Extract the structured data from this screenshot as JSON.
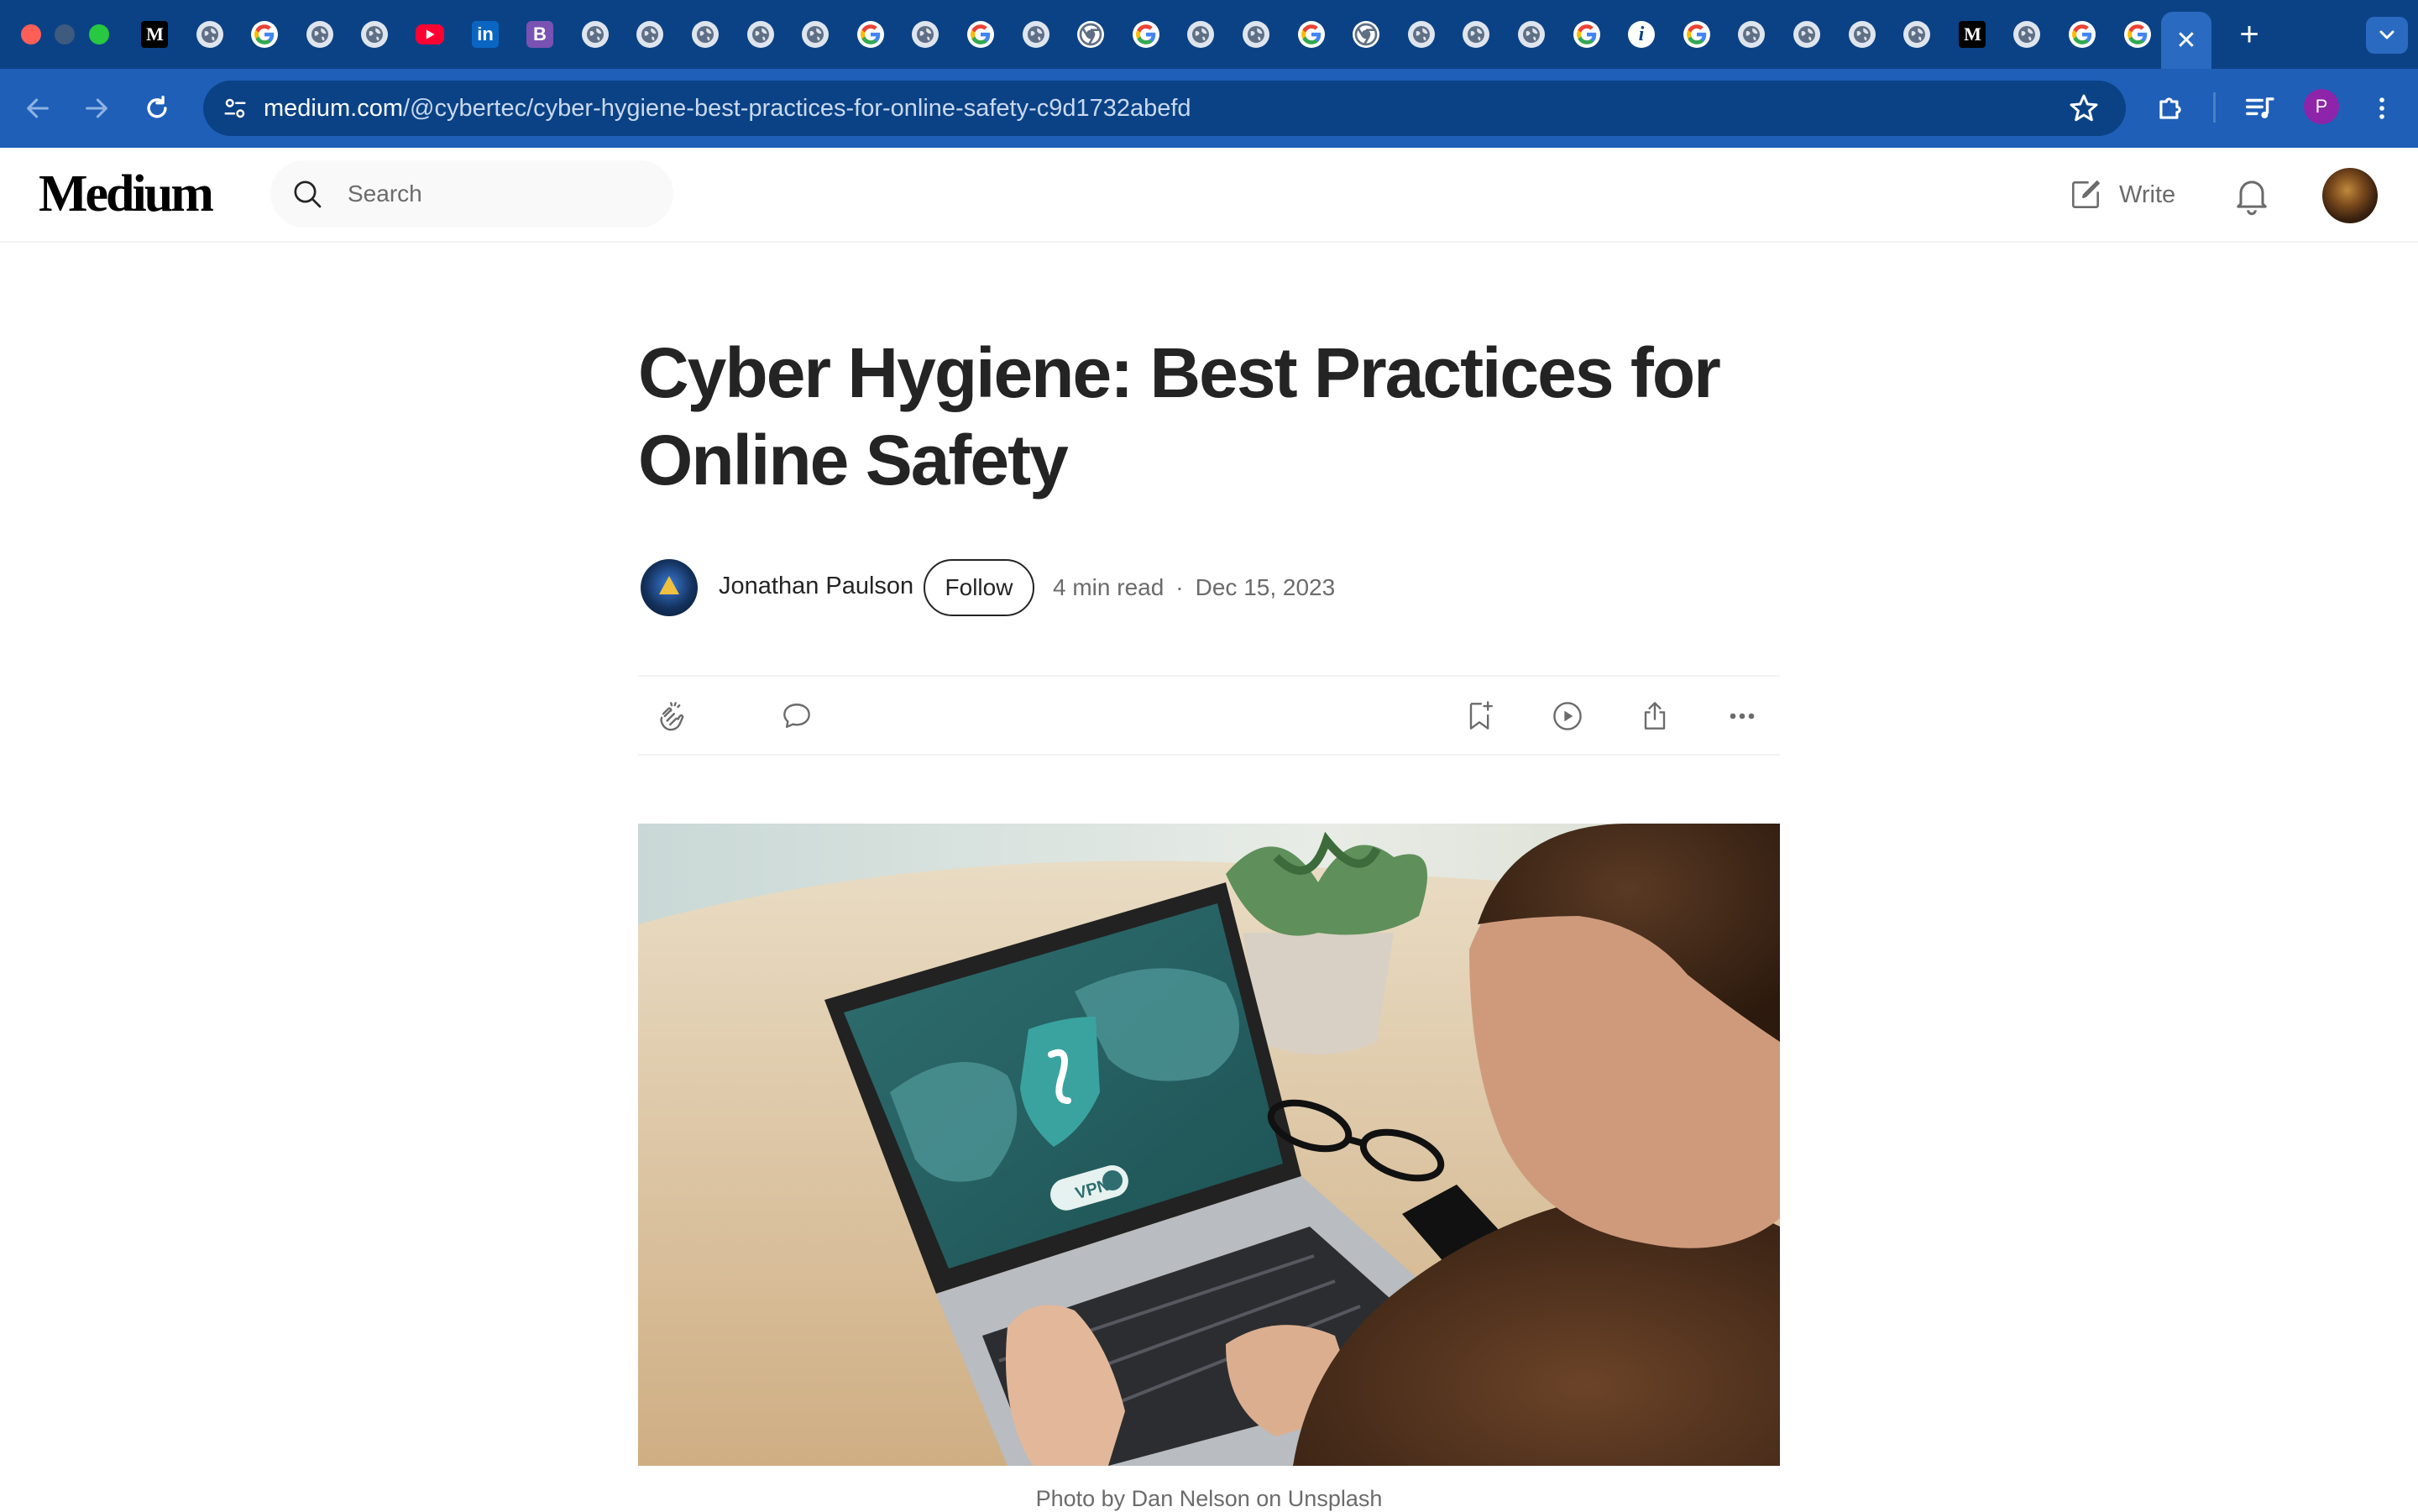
{
  "browser": {
    "tabs": [
      {
        "icon": "medium-favicon"
      },
      {
        "icon": "globe-favicon"
      },
      {
        "icon": "google-favicon"
      },
      {
        "icon": "globe-favicon"
      },
      {
        "icon": "globe-favicon"
      },
      {
        "icon": "youtube-favicon"
      },
      {
        "icon": "linkedin-favicon"
      },
      {
        "icon": "bootstrap-favicon"
      },
      {
        "icon": "globe-favicon"
      },
      {
        "icon": "globe-favicon"
      },
      {
        "icon": "globe-favicon"
      },
      {
        "icon": "globe-favicon"
      },
      {
        "icon": "globe-favicon"
      },
      {
        "icon": "google-favicon"
      },
      {
        "icon": "globe-favicon"
      },
      {
        "icon": "google-favicon"
      },
      {
        "icon": "globe-favicon"
      },
      {
        "icon": "chrome-favicon"
      },
      {
        "icon": "google-favicon"
      },
      {
        "icon": "globe-favicon"
      },
      {
        "icon": "globe-favicon"
      },
      {
        "icon": "google-favicon"
      },
      {
        "icon": "chrome-favicon"
      },
      {
        "icon": "globe-favicon"
      },
      {
        "icon": "globe-favicon"
      },
      {
        "icon": "globe-favicon"
      },
      {
        "icon": "google-favicon"
      },
      {
        "icon": "info-favicon"
      },
      {
        "icon": "google-favicon"
      },
      {
        "icon": "globe-favicon"
      },
      {
        "icon": "globe-favicon"
      },
      {
        "icon": "globe-favicon"
      },
      {
        "icon": "globe-favicon"
      },
      {
        "icon": "medium-favicon"
      },
      {
        "icon": "globe-favicon"
      },
      {
        "icon": "google-favicon"
      },
      {
        "icon": "google-favicon"
      }
    ],
    "medium_favicon_text": "M",
    "linkedin_favicon_text": "in",
    "bootstrap_favicon_text": "B",
    "info_favicon_text": "i",
    "active_tab_close": "✕",
    "new_tab_label": "+",
    "url_host": "medium.com",
    "url_path": "/@cybertec/cyber-hygiene-best-practices-for-online-safety-c9d1732abefd",
    "profile_initial": "P",
    "colors": {
      "tabstrip": "#0b4286",
      "toolbar": "#1f5fb8",
      "omnibox": "#0b4286"
    }
  },
  "site": {
    "logo": "Medium",
    "search_placeholder": "Search",
    "write_label": "Write"
  },
  "article": {
    "title": "Cyber Hygiene: Best Practices for Online Safety",
    "author": "Jonathan Paulson",
    "follow_label": "Follow",
    "read_time": "4 min read",
    "separator": "·",
    "date": "Dec 15, 2023",
    "hero_vpn_label": "VPN",
    "caption": "Photo by Dan Nelson on Unsplash"
  }
}
